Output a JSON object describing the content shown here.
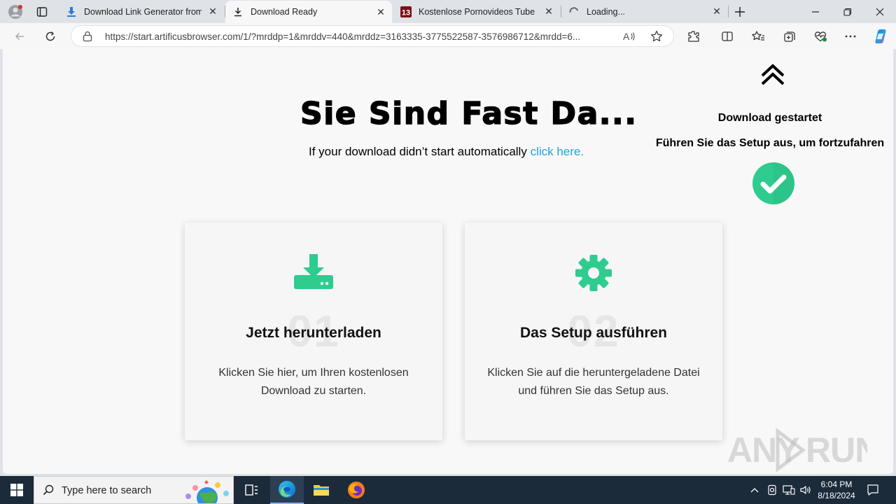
{
  "browser": {
    "tabs": [
      {
        "title": "Download Link Generator from F",
        "active": false,
        "icon": "download-arrow-icon"
      },
      {
        "title": "Download Ready",
        "active": true,
        "icon": "download-icon"
      },
      {
        "title": "Kostenlose Pornovideos Tube & ",
        "active": false,
        "icon": "site-13-icon"
      },
      {
        "title": "Loading...",
        "active": false,
        "icon": "loading-spinner-icon"
      }
    ],
    "address": {
      "url": "https://start.artificusbrowser.com/1/?mrddp=1&mrddv=440&mrddz=3163335-3775522587-3576986712&mrdd=6..."
    }
  },
  "page": {
    "headline": "Sie Sind Fast Da...",
    "subline_text": "If your download didn’t start automatically ",
    "subline_link": "click here.",
    "notice": {
      "started": "Download gestartet",
      "run_setup": "Führen Sie das Setup aus, um fortzufahren"
    },
    "cards": [
      {
        "number": "01",
        "title": "Jetzt herunterladen",
        "description": "Klicken Sie hier, um Ihren kostenlosen Download zu starten.",
        "icon": "download-drive-icon"
      },
      {
        "number": "02",
        "title": "Das Setup ausführen",
        "description": "Klicken Sie auf die heruntergeladene Datei und führen Sie das Setup aus.",
        "icon": "gear-icon"
      }
    ],
    "watermark": "ANY RUN",
    "accent_color": "#2ecc8f",
    "link_color": "#1fa5d8"
  },
  "taskbar": {
    "search_placeholder": "Type here to search",
    "time": "6:04 PM",
    "date": "8/18/2024"
  }
}
